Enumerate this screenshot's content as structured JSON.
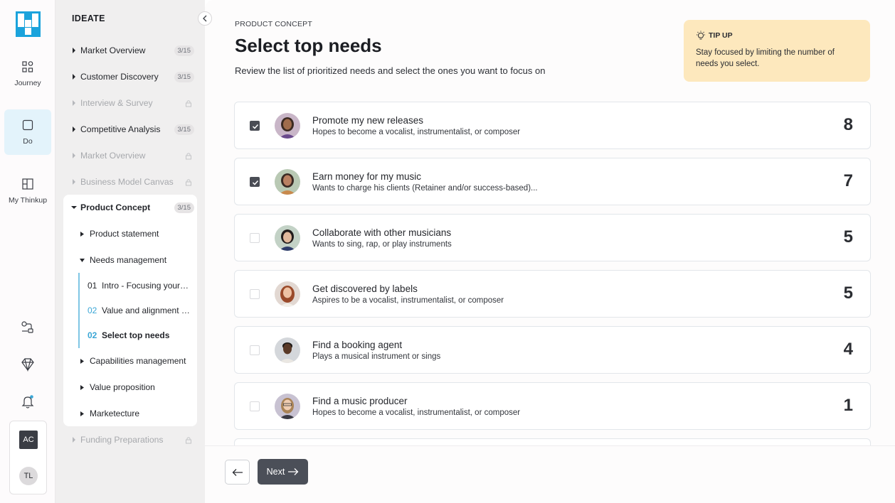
{
  "rail": {
    "items": [
      {
        "label": "Journey",
        "icon": "journey-icon"
      },
      {
        "label": "Do",
        "icon": "do-icon"
      },
      {
        "label": "My Thinkup",
        "icon": "thinkup-icon"
      }
    ],
    "bottom_icons": [
      "flow-icon",
      "diamond-icon",
      "bell-icon"
    ],
    "user": {
      "workspace": "AC",
      "initials": "TL"
    }
  },
  "sidebar": {
    "heading": "IDEATE",
    "items": [
      {
        "label": "Market Overview",
        "count": "3/15",
        "state": "enabled"
      },
      {
        "label": "Customer Discovery",
        "count": "3/15",
        "state": "enabled"
      },
      {
        "label": "Interview & Survey",
        "count": "",
        "state": "locked"
      },
      {
        "label": "Competitive Analysis",
        "count": "3/15",
        "state": "enabled"
      },
      {
        "label": "Market Overview",
        "count": "",
        "state": "locked"
      },
      {
        "label": "Business Model Canvas",
        "count": "",
        "state": "locked"
      },
      {
        "label": "Product Concept",
        "count": "3/15",
        "state": "expanded"
      },
      {
        "label": "Funding Preparations",
        "count": "",
        "state": "locked"
      }
    ],
    "sub_items": [
      {
        "label": "Product statement"
      },
      {
        "label": "Needs management"
      },
      {
        "label": "Capabilities management"
      },
      {
        "label": "Value proposition"
      },
      {
        "label": "Marketecture"
      }
    ],
    "steps": [
      {
        "num": "01",
        "label": "Intro - Focusing your needs"
      },
      {
        "num": "02",
        "label": "Value and alignment matrix"
      },
      {
        "num": "02",
        "label": "Select top needs"
      }
    ]
  },
  "main": {
    "eyebrow": "PRODUCT CONCEPT",
    "title": "Select top needs",
    "subtitle": "Review the list of prioritized needs and select the ones you want to focus on",
    "tip": {
      "heading": "TIP UP",
      "body": "Stay focused by limiting the number of needs you select."
    },
    "needs": [
      {
        "title": "Promote my new releases",
        "desc": "Hopes to become a vocalist, instrumentalist, or composer",
        "score": "8",
        "checked": true
      },
      {
        "title": "Earn money for my music",
        "desc": "Wants to charge his clients (Retainer and/or success-based)...",
        "score": "7",
        "checked": true
      },
      {
        "title": "Collaborate with other musicians",
        "desc": "Wants to sing, rap, or play instruments",
        "score": "5",
        "checked": false
      },
      {
        "title": "Get discovered by labels",
        "desc": "Aspires to be a vocalist, instrumentalist, or composer",
        "score": "5",
        "checked": false
      },
      {
        "title": "Find a booking agent",
        "desc": "Plays a musical instrument or sings",
        "score": "4",
        "checked": false
      },
      {
        "title": "Find a music producer",
        "desc": "Hopes to become a vocalist, instrumentalist, or composer",
        "score": "1",
        "checked": false
      }
    ],
    "footer": {
      "next_label": "Next"
    }
  },
  "colors": {
    "accent_blue": "#3aa6d6",
    "tip_bg": "#fde8bd",
    "primary_btn": "#4b4f58",
    "active_rail": "#e3f3fb"
  }
}
